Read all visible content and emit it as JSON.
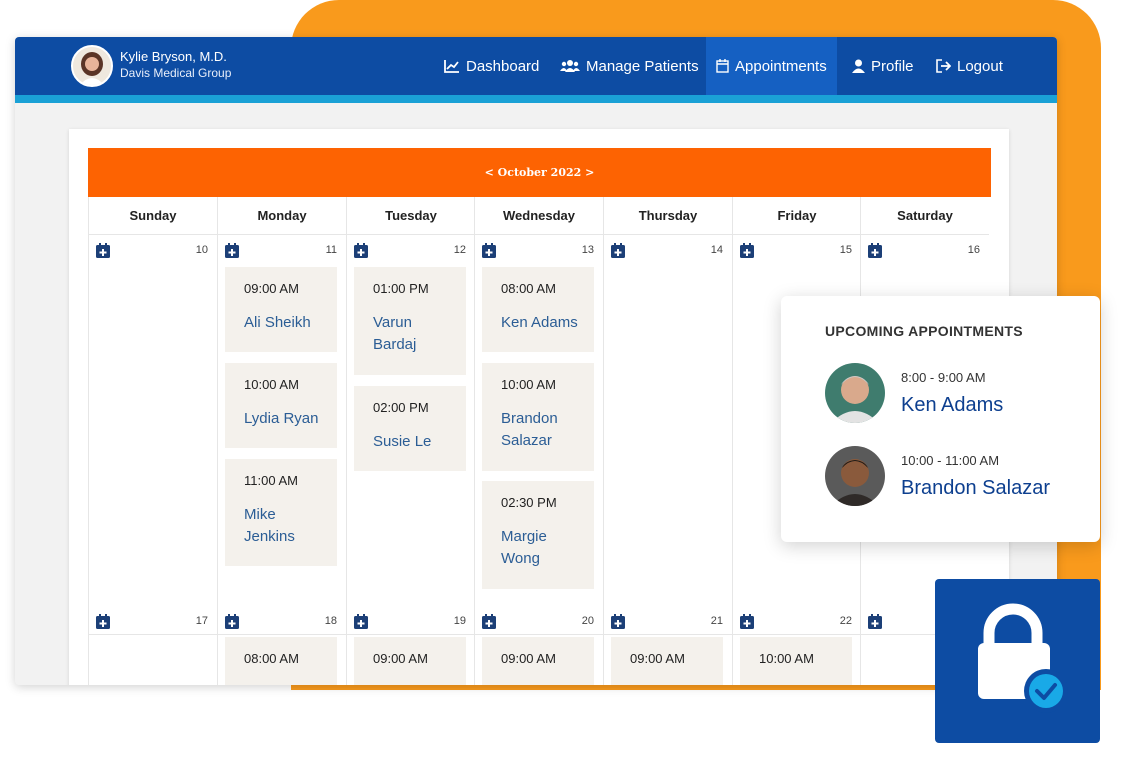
{
  "header": {
    "doctor_name": "Kylie Bryson, M.D.",
    "doctor_org": "Davis Medical Group",
    "nav": [
      {
        "label": "Dashboard",
        "icon": "chart-line-icon"
      },
      {
        "label": "Manage Patients",
        "icon": "users-icon"
      },
      {
        "label": "Appointments",
        "icon": "calendar-icon",
        "active": true
      },
      {
        "label": "Profile",
        "icon": "user-icon"
      },
      {
        "label": "Logout",
        "icon": "sign-out-icon"
      }
    ]
  },
  "calendar": {
    "month_label": "< October 2022 >",
    "days": [
      "Sunday",
      "Monday",
      "Tuesday",
      "Wednesday",
      "Thursday",
      "Friday",
      "Saturday"
    ],
    "week1_dates": [
      "10",
      "11",
      "12",
      "13",
      "14",
      "15",
      "16"
    ],
    "week2_dates": [
      "17",
      "18",
      "19",
      "20",
      "21",
      "22",
      ""
    ],
    "appointments": {
      "mon": [
        {
          "time": "09:00 AM",
          "name": "Ali Sheikh"
        },
        {
          "time": "10:00 AM",
          "name": "Lydia Ryan"
        },
        {
          "time": "11:00 AM",
          "name": "Mike Jenkins"
        }
      ],
      "tue": [
        {
          "time": "01:00 PM",
          "name": "Varun Bardaj"
        },
        {
          "time": "02:00 PM",
          "name": "Susie Le"
        }
      ],
      "wed": [
        {
          "time": "08:00 AM",
          "name": "Ken Adams"
        },
        {
          "time": "10:00 AM",
          "name": "Brandon Salazar"
        },
        {
          "time": "02:30 PM",
          "name": "Margie Wong"
        }
      ],
      "week2": [
        {
          "time": "08:00 AM"
        },
        {
          "time": "09:00 AM"
        },
        {
          "time": "09:00 AM"
        },
        {
          "time": "09:00 AM"
        },
        {
          "time": "10:00 AM"
        }
      ]
    }
  },
  "upcoming": {
    "title": "UPCOMING APPOINTMENTS",
    "items": [
      {
        "time": "8:00 - 9:00 AM",
        "name": "Ken Adams"
      },
      {
        "time": "10:00 - 11:00 AM",
        "name": "Brandon Salazar"
      }
    ]
  },
  "colors": {
    "nav_blue": "#0d4ca3",
    "accent_orange": "#fd6302",
    "bg_orange": "#f99a1c",
    "underline_cyan": "#1aa1d6",
    "check_cyan": "#19a9e7"
  }
}
